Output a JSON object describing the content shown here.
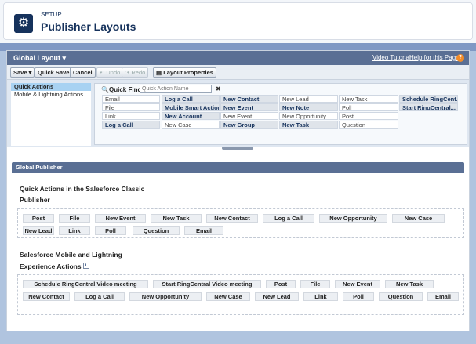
{
  "header": {
    "section": "SETUP",
    "title": "Publisher Layouts"
  },
  "layout_bar": {
    "title": "Global Layout ▾",
    "video_link": "Video Tutorial",
    "help_link": "Help for this Page"
  },
  "toolbar": {
    "save": "Save ▾",
    "quick_save": "Quick Save",
    "cancel": "Cancel",
    "undo": "Undo",
    "redo": "Redo",
    "layout_properties": "Layout Properties"
  },
  "palette": {
    "categories": [
      "Quick Actions",
      "Mobile & Lightning Actions"
    ],
    "quick_find_label": "Quick Find",
    "quick_find_placeholder": "Quick Action Name",
    "quick_find_clear": "✖",
    "cells": [
      [
        "Email",
        "File",
        "Link",
        "Log a Call"
      ],
      [
        "Log a Call",
        "Mobile Smart Action",
        "New Account",
        "New Case"
      ],
      [
        "New Contact",
        "New Event",
        "New Event",
        "New Group"
      ],
      [
        "New Lead",
        "New Note",
        "New Opportunity",
        "New Task"
      ],
      [
        "New Task",
        "Poll",
        "Post",
        "Question"
      ],
      [
        "Schedule RingCent...",
        "Start RingCentral..."
      ]
    ]
  },
  "publisher": {
    "header": "Global Publisher",
    "classic_title_1": "Quick Actions in the Salesforce Classic",
    "classic_title_2": "Publisher",
    "classic_chips": [
      "Post",
      "File",
      "New Event",
      "New Task",
      "New Contact",
      "Log a Call",
      "New Opportunity",
      "New Case",
      "New Lead",
      "Link",
      "Poll",
      "Question",
      "Email"
    ],
    "mobile_title_1": "Salesforce Mobile and Lightning",
    "mobile_title_2": "Experience Actions",
    "mobile_chips": [
      "Schedule RingCentral Video meeting",
      "Start RingCentral Video meeting",
      "Post",
      "File",
      "New Event",
      "New Task",
      "New Contact",
      "Log a Call",
      "New Opportunity",
      "New Case",
      "New Lead",
      "Link",
      "Poll",
      "Question",
      "Email"
    ]
  }
}
